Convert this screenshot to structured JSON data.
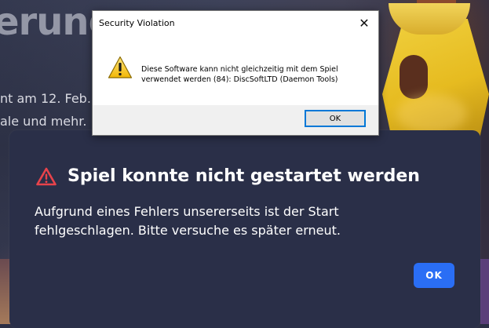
{
  "background": {
    "title_fragment": "erung",
    "line1": "nt am 12. Feb.",
    "line2": "ale und mehr."
  },
  "error_panel": {
    "icon": "warning-triangle-icon",
    "icon_color": "#e8434b",
    "title": "Spiel konnte nicht gestartet werden",
    "message": "Aufgrund eines Fehlers unsererseits ist der Start fehlgeschlagen. Bitte versuche es später erneut.",
    "ok_label": "OK",
    "accent": "#2a6ef5"
  },
  "system_dialog": {
    "title": "Security Violation",
    "close_glyph": "✕",
    "icon": "warning-icon",
    "message": "Diese Software kann nicht gleichzeitig mit dem Spiel verwendet werden (84): DiscSoftLTD (Daemon Tools)",
    "ok_label": "OK"
  }
}
